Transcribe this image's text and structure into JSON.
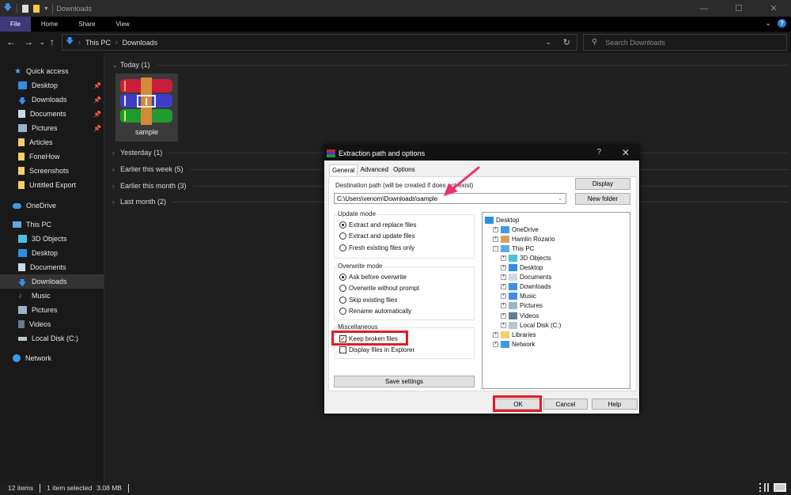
{
  "window": {
    "title": "Downloads",
    "controls": [
      "minimize",
      "maximize",
      "close"
    ]
  },
  "ribbon": {
    "tabs": [
      "File",
      "Home",
      "Share",
      "View"
    ],
    "active_tab": "File"
  },
  "navigation": {
    "breadcrumb": [
      "This PC",
      "Downloads"
    ],
    "search_placeholder": "Search Downloads"
  },
  "sidebar": {
    "quick_access": {
      "label": "Quick access",
      "items": [
        {
          "label": "Desktop",
          "pinned": true
        },
        {
          "label": "Downloads",
          "pinned": true
        },
        {
          "label": "Documents",
          "pinned": true
        },
        {
          "label": "Pictures",
          "pinned": true
        },
        {
          "label": "Articles",
          "pinned": false
        },
        {
          "label": "FoneHow",
          "pinned": false
        },
        {
          "label": "Screenshots",
          "pinned": false
        },
        {
          "label": "Untitled Export",
          "pinned": false
        }
      ]
    },
    "onedrive": "OneDrive",
    "this_pc": {
      "label": "This PC",
      "items": [
        "3D Objects",
        "Desktop",
        "Documents",
        "Downloads",
        "Music",
        "Pictures",
        "Videos",
        "Local Disk (C:)"
      ],
      "selected": "Downloads"
    },
    "network": "Network"
  },
  "main": {
    "groups": [
      {
        "label": "Today (1)",
        "expanded": true
      },
      {
        "label": "Yesterday (1)",
        "expanded": false
      },
      {
        "label": "Earlier this week (5)",
        "expanded": false
      },
      {
        "label": "Earlier this month (3)",
        "expanded": false
      },
      {
        "label": "Last month (2)",
        "expanded": false
      }
    ],
    "file": {
      "name": "sample",
      "icon": "winrar-archive-icon"
    }
  },
  "statusbar": {
    "items_count": "12 items",
    "selection": "1 item selected",
    "size": "3.08 MB"
  },
  "dialog": {
    "title": "Extraction path and options",
    "help": "?",
    "close": "✕",
    "tabs": [
      "General",
      "Advanced",
      "Options"
    ],
    "active_tab": "General",
    "dest_label": "Destination path (will be created if does not exist)",
    "dest_value": "C:\\Users\\venom\\Downloads\\sample",
    "display_button": "Display",
    "new_folder_button": "New folder",
    "update_mode": {
      "label": "Update mode",
      "options": [
        "Extract and replace files",
        "Extract and update files",
        "Fresh existing files only"
      ],
      "selected": 0
    },
    "overwrite_mode": {
      "label": "Overwrite mode",
      "options": [
        "Ask before overwrite",
        "Overwrite without prompt",
        "Skip existing files",
        "Rename automatically"
      ],
      "selected": 0
    },
    "misc": {
      "label": "Miscellaneous",
      "options": [
        {
          "label": "Keep broken files",
          "checked": true
        },
        {
          "label": "Display files in Explorer",
          "checked": false
        }
      ]
    },
    "save_settings": "Save settings",
    "tree": [
      {
        "label": "Desktop",
        "level": 0,
        "expander": "none"
      },
      {
        "label": "OneDrive",
        "level": 1,
        "expander": "+"
      },
      {
        "label": "Hamlin Rozario",
        "level": 1,
        "expander": "+"
      },
      {
        "label": "This PC",
        "level": 1,
        "expander": "-"
      },
      {
        "label": "3D Objects",
        "level": 2,
        "expander": "+"
      },
      {
        "label": "Desktop",
        "level": 2,
        "expander": "+"
      },
      {
        "label": "Documents",
        "level": 2,
        "expander": "+"
      },
      {
        "label": "Downloads",
        "level": 2,
        "expander": "+"
      },
      {
        "label": "Music",
        "level": 2,
        "expander": "+"
      },
      {
        "label": "Pictures",
        "level": 2,
        "expander": "+"
      },
      {
        "label": "Videos",
        "level": 2,
        "expander": "+"
      },
      {
        "label": "Local Disk (C:)",
        "level": 2,
        "expander": "+"
      },
      {
        "label": "Libraries",
        "level": 1,
        "expander": "+"
      },
      {
        "label": "Network",
        "level": 1,
        "expander": "+"
      }
    ],
    "ok": "OK",
    "cancel": "Cancel",
    "help_button": "Help"
  },
  "annotations": {
    "highlight_color": "#e31b23",
    "arrow_color": "#e8336d"
  }
}
